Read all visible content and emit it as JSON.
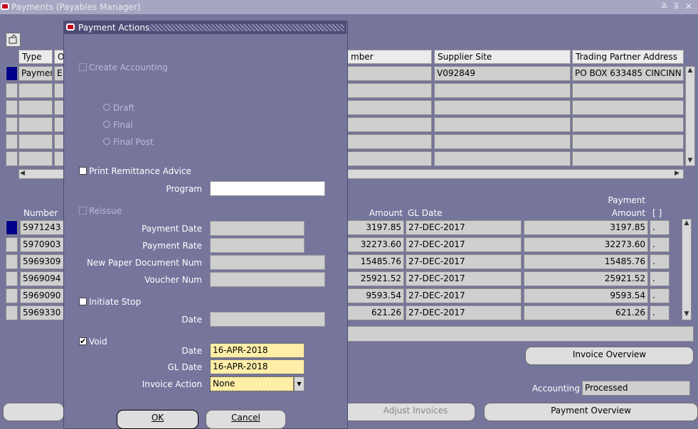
{
  "window": {
    "title": "Payments (Payables Manager)",
    "controls": "≚ ⊼ ✕"
  },
  "payments_table": {
    "headers": {
      "type": "Type",
      "o": "O",
      "number": "mber",
      "supplier_site": "Supplier Site",
      "trading_partner_address": "Trading Partner Address"
    },
    "rows": [
      {
        "type": "Paymen",
        "o": "E",
        "supplier_site": "V092849",
        "address": "PO BOX 633485  CINCINN"
      }
    ]
  },
  "invoices_table": {
    "headers": {
      "number": "Number",
      "amount": "Amount",
      "gl_date": "GL Date",
      "payment_amount_line1": "Payment",
      "payment_amount_line2": "Amount",
      "bracket": "[ ]"
    },
    "rows": [
      {
        "number": "5971243",
        "amount": "3197.85",
        "gl_date": "27-DEC-2017",
        "payment_amount": "3197.85",
        "flag": "."
      },
      {
        "number": "5970903",
        "amount": "32273.60",
        "gl_date": "27-DEC-2017",
        "payment_amount": "32273.60",
        "flag": "."
      },
      {
        "number": "5969309",
        "amount": "15485.76",
        "gl_date": "27-DEC-2017",
        "payment_amount": "15485.76",
        "flag": "."
      },
      {
        "number": "5969094",
        "amount": "25921.52",
        "gl_date": "27-DEC-2017",
        "payment_amount": "25921.52",
        "flag": "."
      },
      {
        "number": "5969090",
        "amount": "9593.54",
        "gl_date": "27-DEC-2017",
        "payment_amount": "9593.54",
        "flag": "."
      },
      {
        "number": "5969330",
        "amount": "621.26",
        "gl_date": "27-DEC-2017",
        "payment_amount": "621.26",
        "flag": "."
      }
    ]
  },
  "main_buttons": {
    "invoice_overview": "Invoice Overview",
    "adjust_invoices": "Adjust Invoices",
    "payment_overview": "Payment Overview"
  },
  "accounting": {
    "label": "Accounting",
    "value": "Processed"
  },
  "dialog": {
    "title": "Payment Actions",
    "create_accounting": {
      "label": "Create Accounting",
      "checked": false,
      "enabled": false
    },
    "radios": {
      "draft": "Draft",
      "final": "Final",
      "final_post": "Final Post"
    },
    "print_remittance": {
      "label": "Print Remittance Advice",
      "checked": false
    },
    "program_label": "Program",
    "program_value": "",
    "reissue": {
      "label": "Reissue",
      "checked": false,
      "enabled": false
    },
    "payment_date_label": "Payment Date",
    "payment_rate_label": "Payment Rate",
    "new_paper_doc_label": "New Paper Document Num",
    "voucher_num_label": "Voucher Num",
    "initiate_stop": {
      "label": "Initiate Stop",
      "checked": false
    },
    "stop_date_label": "Date",
    "void": {
      "label": "Void",
      "checked": true
    },
    "void_date_label": "Date",
    "void_date_value": "16-APR-2018",
    "gl_date_label": "GL Date",
    "gl_date_value": "16-APR-2018",
    "invoice_action_label": "Invoice Action",
    "invoice_action_value": "None",
    "ok_label": "OK",
    "cancel_label": "Cancel"
  }
}
